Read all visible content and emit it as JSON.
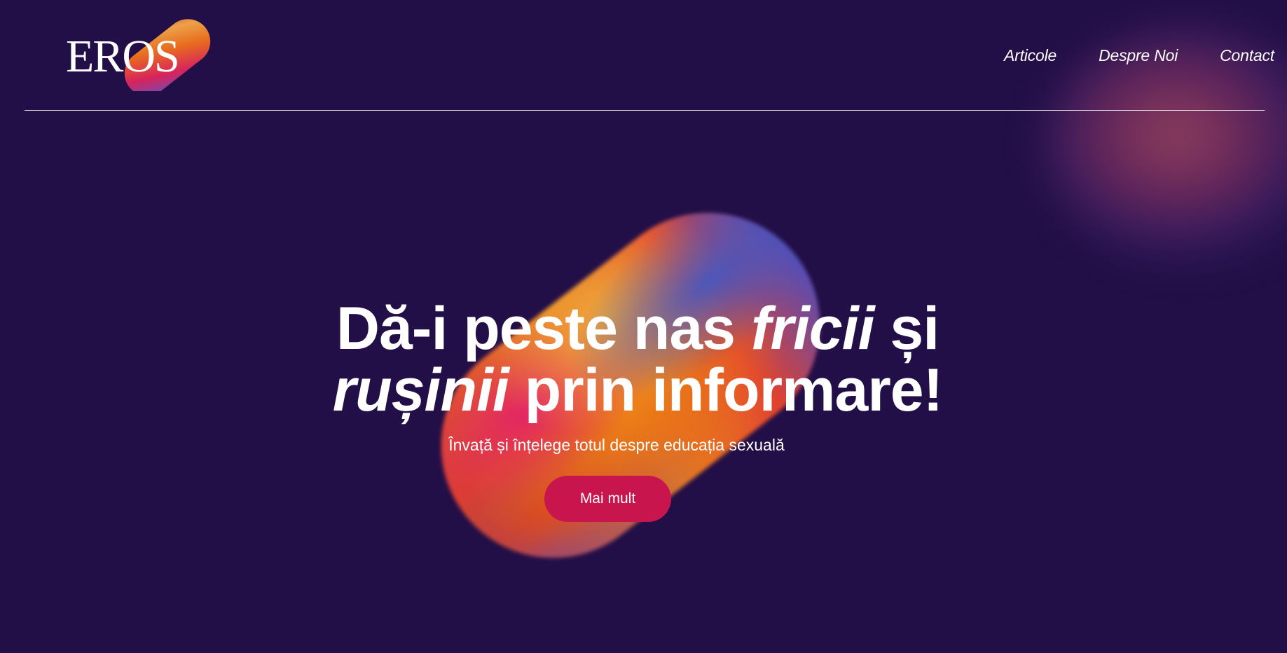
{
  "brand": {
    "logo_text": "EROS"
  },
  "nav": {
    "items": [
      {
        "label": "Articole"
      },
      {
        "label": "Despre Noi"
      },
      {
        "label": "Contact"
      }
    ]
  },
  "hero": {
    "headline": {
      "part1": "Dă-i peste nas ",
      "italic1": "fricii",
      "part2": " și ",
      "italic2": "rușinii",
      "part3": " prin informare!"
    },
    "subtitle": "Învață și înțelege totul despre educația sexuală",
    "cta_label": "Mai mult"
  },
  "colors": {
    "background": "#230f47",
    "cta": "#c8154e",
    "text": "#ffffff"
  }
}
